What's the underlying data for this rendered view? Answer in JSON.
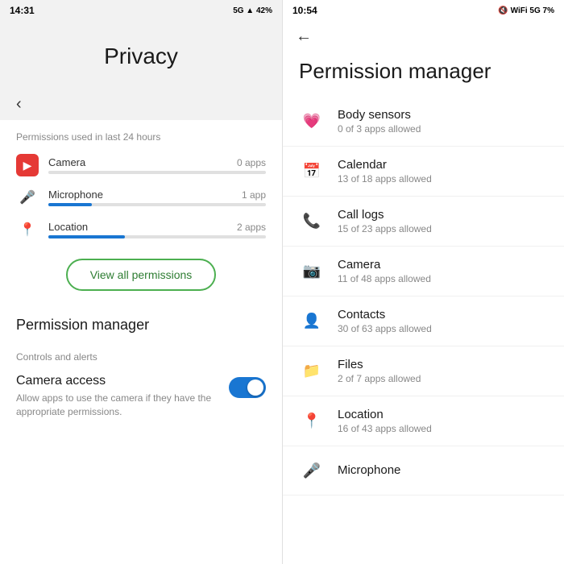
{
  "left": {
    "status_bar": {
      "time": "14:31",
      "icons": "5G ▲ 42%"
    },
    "privacy_title": "Privacy",
    "back_label": "‹",
    "permissions_label": "Permissions used in last 24 hours",
    "permissions": [
      {
        "name": "Camera",
        "count": "0 apps",
        "fill_pct": 0,
        "icon_type": "camera",
        "icon": "▶"
      },
      {
        "name": "Microphone",
        "count": "1 app",
        "fill_pct": 20,
        "icon_type": "mic",
        "icon": "🎤"
      },
      {
        "name": "Location",
        "count": "2 apps",
        "fill_pct": 35,
        "icon_type": "location",
        "icon": "📍"
      }
    ],
    "view_all_btn": "View all permissions",
    "permission_manager_label": "Permission manager",
    "controls_label": "Controls and alerts",
    "camera_access_title": "Camera access",
    "camera_access_desc": "Allow apps to use the camera if they have the appropriate permissions."
  },
  "right": {
    "status_bar": {
      "time": "10:54",
      "icons": "🔇 WiFi 5G 7%"
    },
    "back_label": "←",
    "title": "Permission manager",
    "items": [
      {
        "name": "Body sensors",
        "sub": "0 of 3 apps allowed",
        "icon": "💗"
      },
      {
        "name": "Calendar",
        "sub": "13 of 18 apps allowed",
        "icon": "📅"
      },
      {
        "name": "Call logs",
        "sub": "15 of 23 apps allowed",
        "icon": "📞"
      },
      {
        "name": "Camera",
        "sub": "11 of 48 apps allowed",
        "icon": "📷"
      },
      {
        "name": "Contacts",
        "sub": "30 of 63 apps allowed",
        "icon": "👤"
      },
      {
        "name": "Files",
        "sub": "2 of 7 apps allowed",
        "icon": "📁"
      },
      {
        "name": "Location",
        "sub": "16 of 43 apps allowed",
        "icon": "📍"
      },
      {
        "name": "Microphone",
        "sub": "",
        "icon": "🎤"
      }
    ]
  }
}
